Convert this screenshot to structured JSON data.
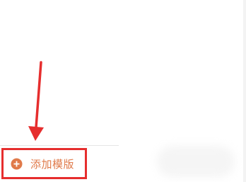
{
  "footer": {
    "add_template_label": "添加模版",
    "add_icon": "plus-circle-icon"
  },
  "annotation": {
    "arrow_icon": "arrow-down-icon",
    "highlight_color": "#e62e2e"
  },
  "colors": {
    "accent": "#e07a4a"
  }
}
